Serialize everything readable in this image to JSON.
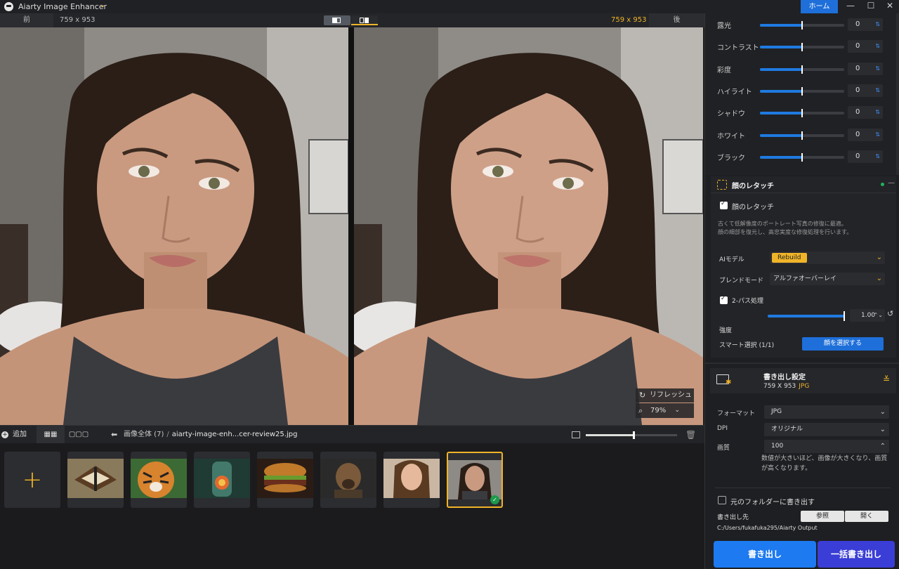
{
  "app": {
    "title": "Aiarty Image Enhancer",
    "home_tab": "ホーム"
  },
  "compare": {
    "before_label": "前",
    "before_size": "759 x 953",
    "after_size": "759 x 953",
    "after_label": "後"
  },
  "preview": {
    "refresh_label": "リフレッシュ",
    "zoom": "79%"
  },
  "filebar": {
    "add_label": "追加",
    "breadcrumb_root": "画像全体 (7)",
    "breadcrumb_sep": "/",
    "breadcrumb_file": "aiarty-image-enh...cer-review25.jpg",
    "thumb_size_level": 0.52
  },
  "thumbnails": [
    {
      "name": "butterfly"
    },
    {
      "name": "tiger"
    },
    {
      "name": "bottle"
    },
    {
      "name": "burger"
    },
    {
      "name": "dog"
    },
    {
      "name": "woman"
    },
    {
      "name": "selected-portrait",
      "selected": true
    }
  ],
  "adjustments": [
    {
      "label": "露光",
      "value": "0",
      "level": 0.5
    },
    {
      "label": "コントラスト",
      "value": "0",
      "level": 0.5
    },
    {
      "label": "彩度",
      "value": "0",
      "level": 0.5
    },
    {
      "label": "ハイライト",
      "value": "0",
      "level": 0.5
    },
    {
      "label": "シャドウ",
      "value": "0",
      "level": 0.5
    },
    {
      "label": "ホワイト",
      "value": "0",
      "level": 0.5
    },
    {
      "label": "ブラック",
      "value": "0",
      "level": 0.5
    }
  ],
  "face": {
    "title": "顔のレタッチ",
    "enable_label": "顔のレタッチ",
    "desc_line1": "古くて低解像度のポートレート写真の修復に最適。",
    "desc_line2": "顔の細部を復元し、高忠実度な修復処理を行います。",
    "ai_model_label": "AIモデル",
    "ai_model_value": "Rebuild",
    "blend_label": "ブレンドモード",
    "blend_value": "アルファオーバーレイ",
    "twopass_label": "2-パス処理",
    "strength_label": "強度",
    "strength_value": "1.00",
    "strength_level": 1.0,
    "smart_select_label": "スマート選択 (1/1)",
    "select_face_button": "顔を選択する"
  },
  "export": {
    "title": "書き出し設定",
    "size": "759 X 953",
    "format_badge": "JPG",
    "format_label": "フォーマット",
    "format_value": "JPG",
    "dpi_label": "DPI",
    "dpi_value": "オリジナル",
    "quality_label": "画質",
    "quality_value": "100",
    "quality_note": "数値が大きいほど、画像が大きくなり、画質が高くなります。",
    "orig_folder_label": "元のフォルダーに書き出す",
    "dest_label": "書き出し先",
    "browse_button": "参照",
    "open_button": "開く",
    "path": "C:/Users/fukafuka295/Aiarty Output",
    "export_button": "書き出し",
    "batch_export_button": "一括書き出し"
  },
  "colors": {
    "accent": "#f0b429",
    "primary": "#1e6fd9",
    "success": "#1d9a4b"
  },
  "icons": [
    "app-logo-icon",
    "caret-down-icon",
    "minimize-icon",
    "maximize-icon",
    "close-icon",
    "refresh-icon",
    "zoom-icon",
    "plus-icon",
    "grid-icon",
    "list-icon",
    "back-arrow-icon",
    "image-icon",
    "trash-icon",
    "face-scan-icon",
    "export-settings-icon",
    "reset-icon",
    "check-icon"
  ]
}
